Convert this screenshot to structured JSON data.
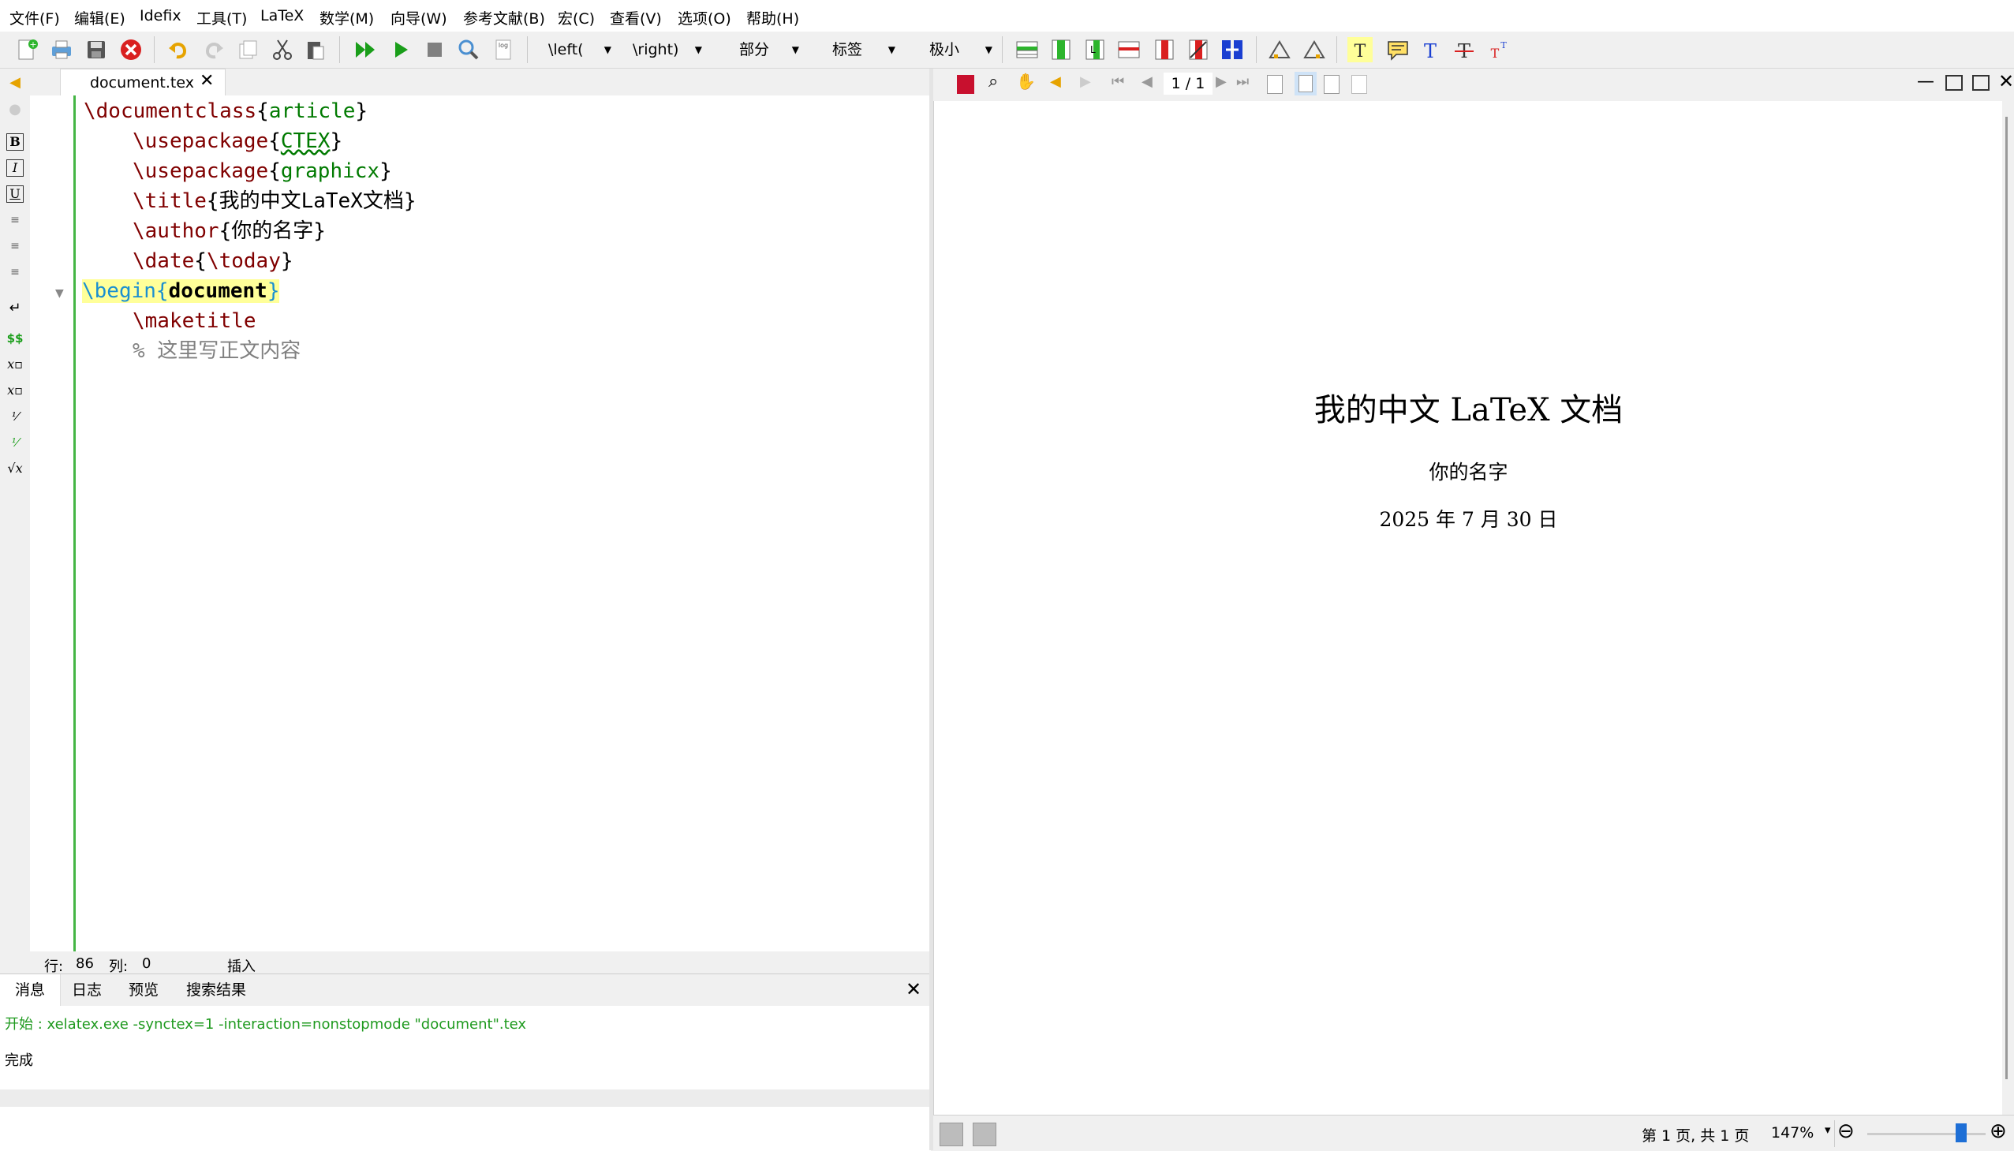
{
  "menu": [
    "文件(F)",
    "编辑(E)",
    "Idefix",
    "工具(T)",
    "LaTeX",
    "数学(M)",
    "向导(W)",
    "参考文献(B)",
    "宏(C)",
    "查看(V)",
    "选项(O)",
    "帮助(H)"
  ],
  "toolbar": {
    "left_combo": "\\left(",
    "right_combo": "\\right)",
    "section_combo": "部分",
    "label_combo": "标签",
    "size_combo": "极小"
  },
  "editor": {
    "tab_name": "document.tex",
    "lines": {
      "l1": {
        "cmd": "\\documentclass",
        "arg": "article"
      },
      "l2": {
        "cmd": "\\usepackage",
        "arg": "CTEX"
      },
      "l3": {
        "cmd": "\\usepackage",
        "arg": "graphicx"
      },
      "l4": {
        "cmd": "\\title",
        "arg": "我的中文LaTeX文档"
      },
      "l5": {
        "cmd": "\\author",
        "arg": "你的名字"
      },
      "l6": {
        "cmd": "\\date",
        "arg": "\\today"
      },
      "l7": {
        "cmd": "\\begin",
        "arg": "document"
      },
      "l8": {
        "cmd": "\\maketitle"
      },
      "l9": {
        "comment": "% 这里写正文内容"
      }
    },
    "status": {
      "line_label": "行:",
      "line_value": "86",
      "col_label": "列:",
      "col_value": "0",
      "mode": "插入"
    }
  },
  "panel": {
    "tabs": [
      "消息",
      "日志",
      "预览",
      "搜索结果"
    ],
    "start_line": "开始 : xelatex.exe -synctex=1 -interaction=nonstopmode \"document\".tex",
    "done_line": "完成"
  },
  "preview": {
    "page_indicator": "1 / 1",
    "title": "我的中文 LaTeX 文档",
    "author": "你的名字",
    "date": "2025 年 7 月 30 日",
    "status_pages": "第 1 页, 共 1 页",
    "zoom": "147%",
    "zoom_level_fraction": 0.82
  },
  "colors": {
    "command": "#800000",
    "argument": "#007a00",
    "comment": "#808080",
    "begin": "#1a8fd1",
    "gutter_green": "#44b544",
    "messages_green": "#1f9a1f"
  }
}
